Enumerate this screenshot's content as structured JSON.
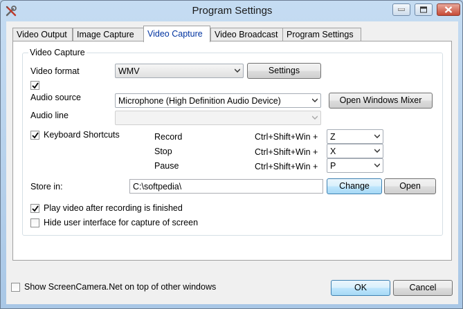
{
  "window": {
    "title": "Program Settings",
    "app_icon": "wrench-screwdriver-icon"
  },
  "tabs": [
    {
      "label": "Video Output",
      "active": false
    },
    {
      "label": "Image Capture",
      "active": false
    },
    {
      "label": "Video Capture",
      "active": true
    },
    {
      "label": "Video Broadcast",
      "active": false
    },
    {
      "label": "Program Settings",
      "active": false
    }
  ],
  "video_capture": {
    "group_label": "Video Capture",
    "video_format": {
      "label": "Video format",
      "value": "WMV",
      "settings_button": "Settings"
    },
    "audio_enabled_checked": true,
    "audio_source": {
      "label": "Audio source",
      "value": "Microphone (High Definition Audio Device)",
      "mixer_button": "Open Windows Mixer"
    },
    "audio_line": {
      "label": "Audio line",
      "value": ""
    },
    "keyboard_shortcuts": {
      "label": "Keyboard Shortcuts",
      "checked": true,
      "rows": [
        {
          "action": "Record",
          "modifier": "Ctrl+Shift+Win +",
          "key": "Z"
        },
        {
          "action": "Stop",
          "modifier": "Ctrl+Shift+Win +",
          "key": "X"
        },
        {
          "action": "Pause",
          "modifier": "Ctrl+Shift+Win +",
          "key": "P"
        }
      ]
    },
    "store_in": {
      "label": "Store in:",
      "value": "C:\\softpedia\\",
      "change_button": "Change",
      "open_button": "Open"
    },
    "play_after": {
      "label": "Play video after recording is finished",
      "checked": true
    },
    "hide_ui": {
      "label": "Hide user interface for capture of screen",
      "checked": false
    }
  },
  "footer": {
    "on_top": {
      "label": "Show ScreenCamera.Net on top of other windows",
      "checked": false
    },
    "ok_button": "OK",
    "cancel_button": "Cancel"
  },
  "colors": {
    "active_tab_text": "#0033a0",
    "window_frame": "#b9d1ea"
  }
}
